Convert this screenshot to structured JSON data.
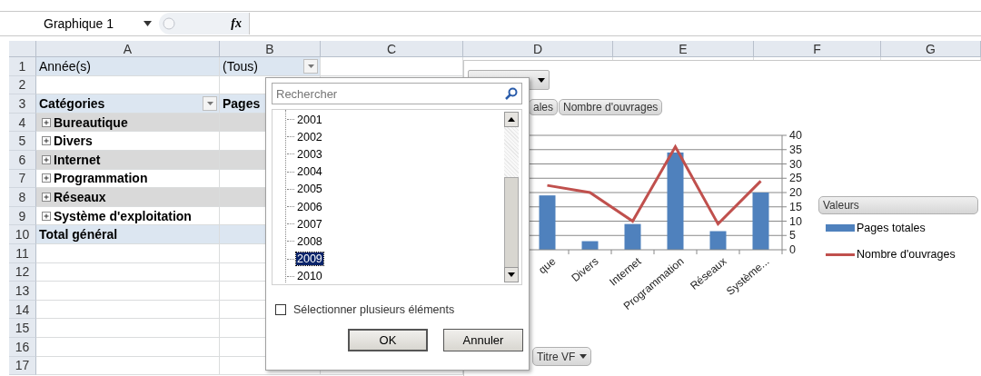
{
  "name_box": {
    "value": "Graphique 1"
  },
  "formula_bar": {
    "function_label": "fx"
  },
  "columns": [
    "A",
    "B",
    "C",
    "D",
    "E",
    "F",
    "G"
  ],
  "rows": [
    {
      "number": "1",
      "kind": "filter",
      "a": "Année(s)",
      "b": "(Tous)"
    },
    {
      "number": "2",
      "kind": "blank"
    },
    {
      "number": "3",
      "kind": "header",
      "a": "Catégories",
      "b": "Pages"
    },
    {
      "number": "4",
      "kind": "category",
      "shaded": true,
      "expanded": false,
      "a": "Bureautique"
    },
    {
      "number": "5",
      "kind": "category",
      "shaded": false,
      "expanded": false,
      "a": "Divers"
    },
    {
      "number": "6",
      "kind": "category",
      "shaded": true,
      "expanded": false,
      "a": "Internet"
    },
    {
      "number": "7",
      "kind": "category",
      "shaded": false,
      "expanded": false,
      "a": "Programmation"
    },
    {
      "number": "8",
      "kind": "category",
      "shaded": true,
      "expanded": false,
      "a": "Réseaux"
    },
    {
      "number": "9",
      "kind": "category",
      "shaded": false,
      "expanded": false,
      "a": "Système d'exploitation"
    },
    {
      "number": "10",
      "kind": "total",
      "a": "Total général"
    },
    {
      "number": "11",
      "kind": "empty"
    },
    {
      "number": "12",
      "kind": "empty"
    },
    {
      "number": "13",
      "kind": "empty"
    },
    {
      "number": "14",
      "kind": "empty"
    },
    {
      "number": "15",
      "kind": "empty"
    },
    {
      "number": "16",
      "kind": "empty"
    },
    {
      "number": "17",
      "kind": "empty"
    }
  ],
  "filter_popup": {
    "search": {
      "placeholder": "Rechercher"
    },
    "years": [
      {
        "label": "2001",
        "selected": false
      },
      {
        "label": "2002",
        "selected": false
      },
      {
        "label": "2003",
        "selected": false
      },
      {
        "label": "2004",
        "selected": false
      },
      {
        "label": "2005",
        "selected": false
      },
      {
        "label": "2006",
        "selected": false
      },
      {
        "label": "2007",
        "selected": false
      },
      {
        "label": "2008",
        "selected": false
      },
      {
        "label": "2009",
        "selected": true
      },
      {
        "label": "2010",
        "selected": false
      }
    ],
    "multi_select": {
      "label": "Sélectionner plusieurs éléments",
      "checked": false
    },
    "buttons": [
      "OK",
      "Annuler"
    ]
  },
  "chart": {
    "value_buttons": [
      {
        "label": "ales"
      },
      {
        "label": "Nombre d'ouvrages"
      }
    ],
    "axis_button": {
      "label": "Titre VF"
    },
    "legend_title": "Valeurs",
    "chart_data": {
      "type": "bar",
      "categories": [
        "que",
        "Divers",
        "Internet",
        "Programmation",
        "Réseaux",
        "Système..."
      ],
      "series": [
        {
          "name": "Pages totales",
          "type": "bar",
          "color": "#4f81bd",
          "values": [
            19,
            3,
            9,
            34,
            6.5,
            20
          ]
        },
        {
          "name": "Nombre d'ouvrages",
          "type": "line",
          "color": "#c0504d",
          "values": [
            22.5,
            20,
            10,
            36,
            9,
            24
          ]
        }
      ],
      "grid": true,
      "ylim": [
        0,
        40
      ],
      "yticks": [
        0,
        5,
        10,
        15,
        20,
        25,
        30,
        35,
        40
      ]
    }
  }
}
